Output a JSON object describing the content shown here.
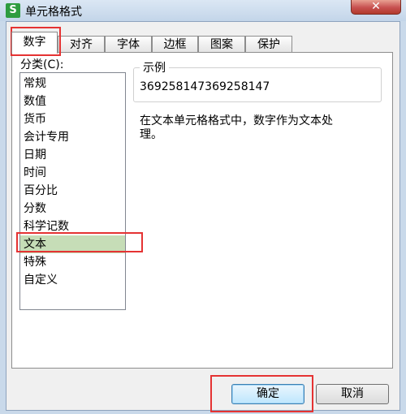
{
  "window": {
    "title": "单元格格式",
    "app_icon": "S",
    "close": "✕"
  },
  "tabs": [
    {
      "label": "数字",
      "active": true
    },
    {
      "label": "对齐",
      "active": false
    },
    {
      "label": "字体",
      "active": false
    },
    {
      "label": "边框",
      "active": false
    },
    {
      "label": "图案",
      "active": false
    },
    {
      "label": "保护",
      "active": false
    }
  ],
  "category": {
    "label": "分类(C):",
    "items": [
      "常规",
      "数值",
      "货币",
      "会计专用",
      "日期",
      "时间",
      "百分比",
      "分数",
      "科学记数",
      "文本",
      "特殊",
      "自定义"
    ],
    "selected": "文本"
  },
  "sample": {
    "legend": "示例",
    "value": "369258147369258147"
  },
  "description": "在文本单元格格式中，数字作为文本处理。",
  "buttons": {
    "ok": "确定",
    "cancel": "取消"
  },
  "colors": {
    "highlight_box": "#e53333",
    "selected_item": "#c6ddb7"
  }
}
